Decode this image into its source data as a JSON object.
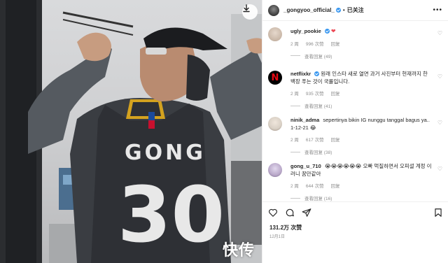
{
  "header": {
    "username": "_gongyoo_official_",
    "separator": "•",
    "follow_state": "已关注",
    "more": "•••"
  },
  "photo": {
    "jersey_name": "GONG",
    "jersey_number": "30",
    "jersey_logo": "NBA",
    "watermark": "快传"
  },
  "comments": [
    {
      "username": "ugly_pookie",
      "text": "",
      "time": "2 周",
      "likes": "996 次赞",
      "reply": "回复",
      "replies": "查看回复 (49)",
      "avatar_color": "#c8b6a6"
    },
    {
      "username": "netflixkr",
      "text": "원래 인스타 새로 열면 과거 사진부터 현재까지 한 백장 푸는 것이 국룰입니다.",
      "time": "2 周",
      "likes": "935 次赞",
      "reply": "回复",
      "replies": "查看回复 (41)",
      "avatar_color": "#000000",
      "brand_color": "#e50914"
    },
    {
      "username": "ninik_adma",
      "text": "sepertinya bikin IG nunggu tanggal bagus ya.. 1-12-21 😂",
      "time": "2 周",
      "likes": "617 次赞",
      "reply": "回复",
      "replies": "查看回复 (38)",
      "avatar_color": "#d8cfc4"
    },
    {
      "username": "gong_u_710",
      "text": "😭😭😭😭😭😭 오빠 먹질하면서 오피셜 계정 이러니 꿈만같아",
      "time": "2 周",
      "likes": "644 次赞",
      "reply": "回复",
      "replies": "查看回复 (16)",
      "avatar_color": "#b9a8c9"
    }
  ],
  "actions": {
    "like_icon": "heart-outline-icon",
    "comment_icon": "comment-bubble-icon",
    "share_icon": "paper-plane-icon",
    "save_icon": "bookmark-icon"
  },
  "footer": {
    "likes": "131.2万 次赞",
    "date": "12月1日"
  },
  "colors": {
    "accent_blue": "#3897f0",
    "heart_red": "#ed4956",
    "muted": "#8e8e8e"
  }
}
